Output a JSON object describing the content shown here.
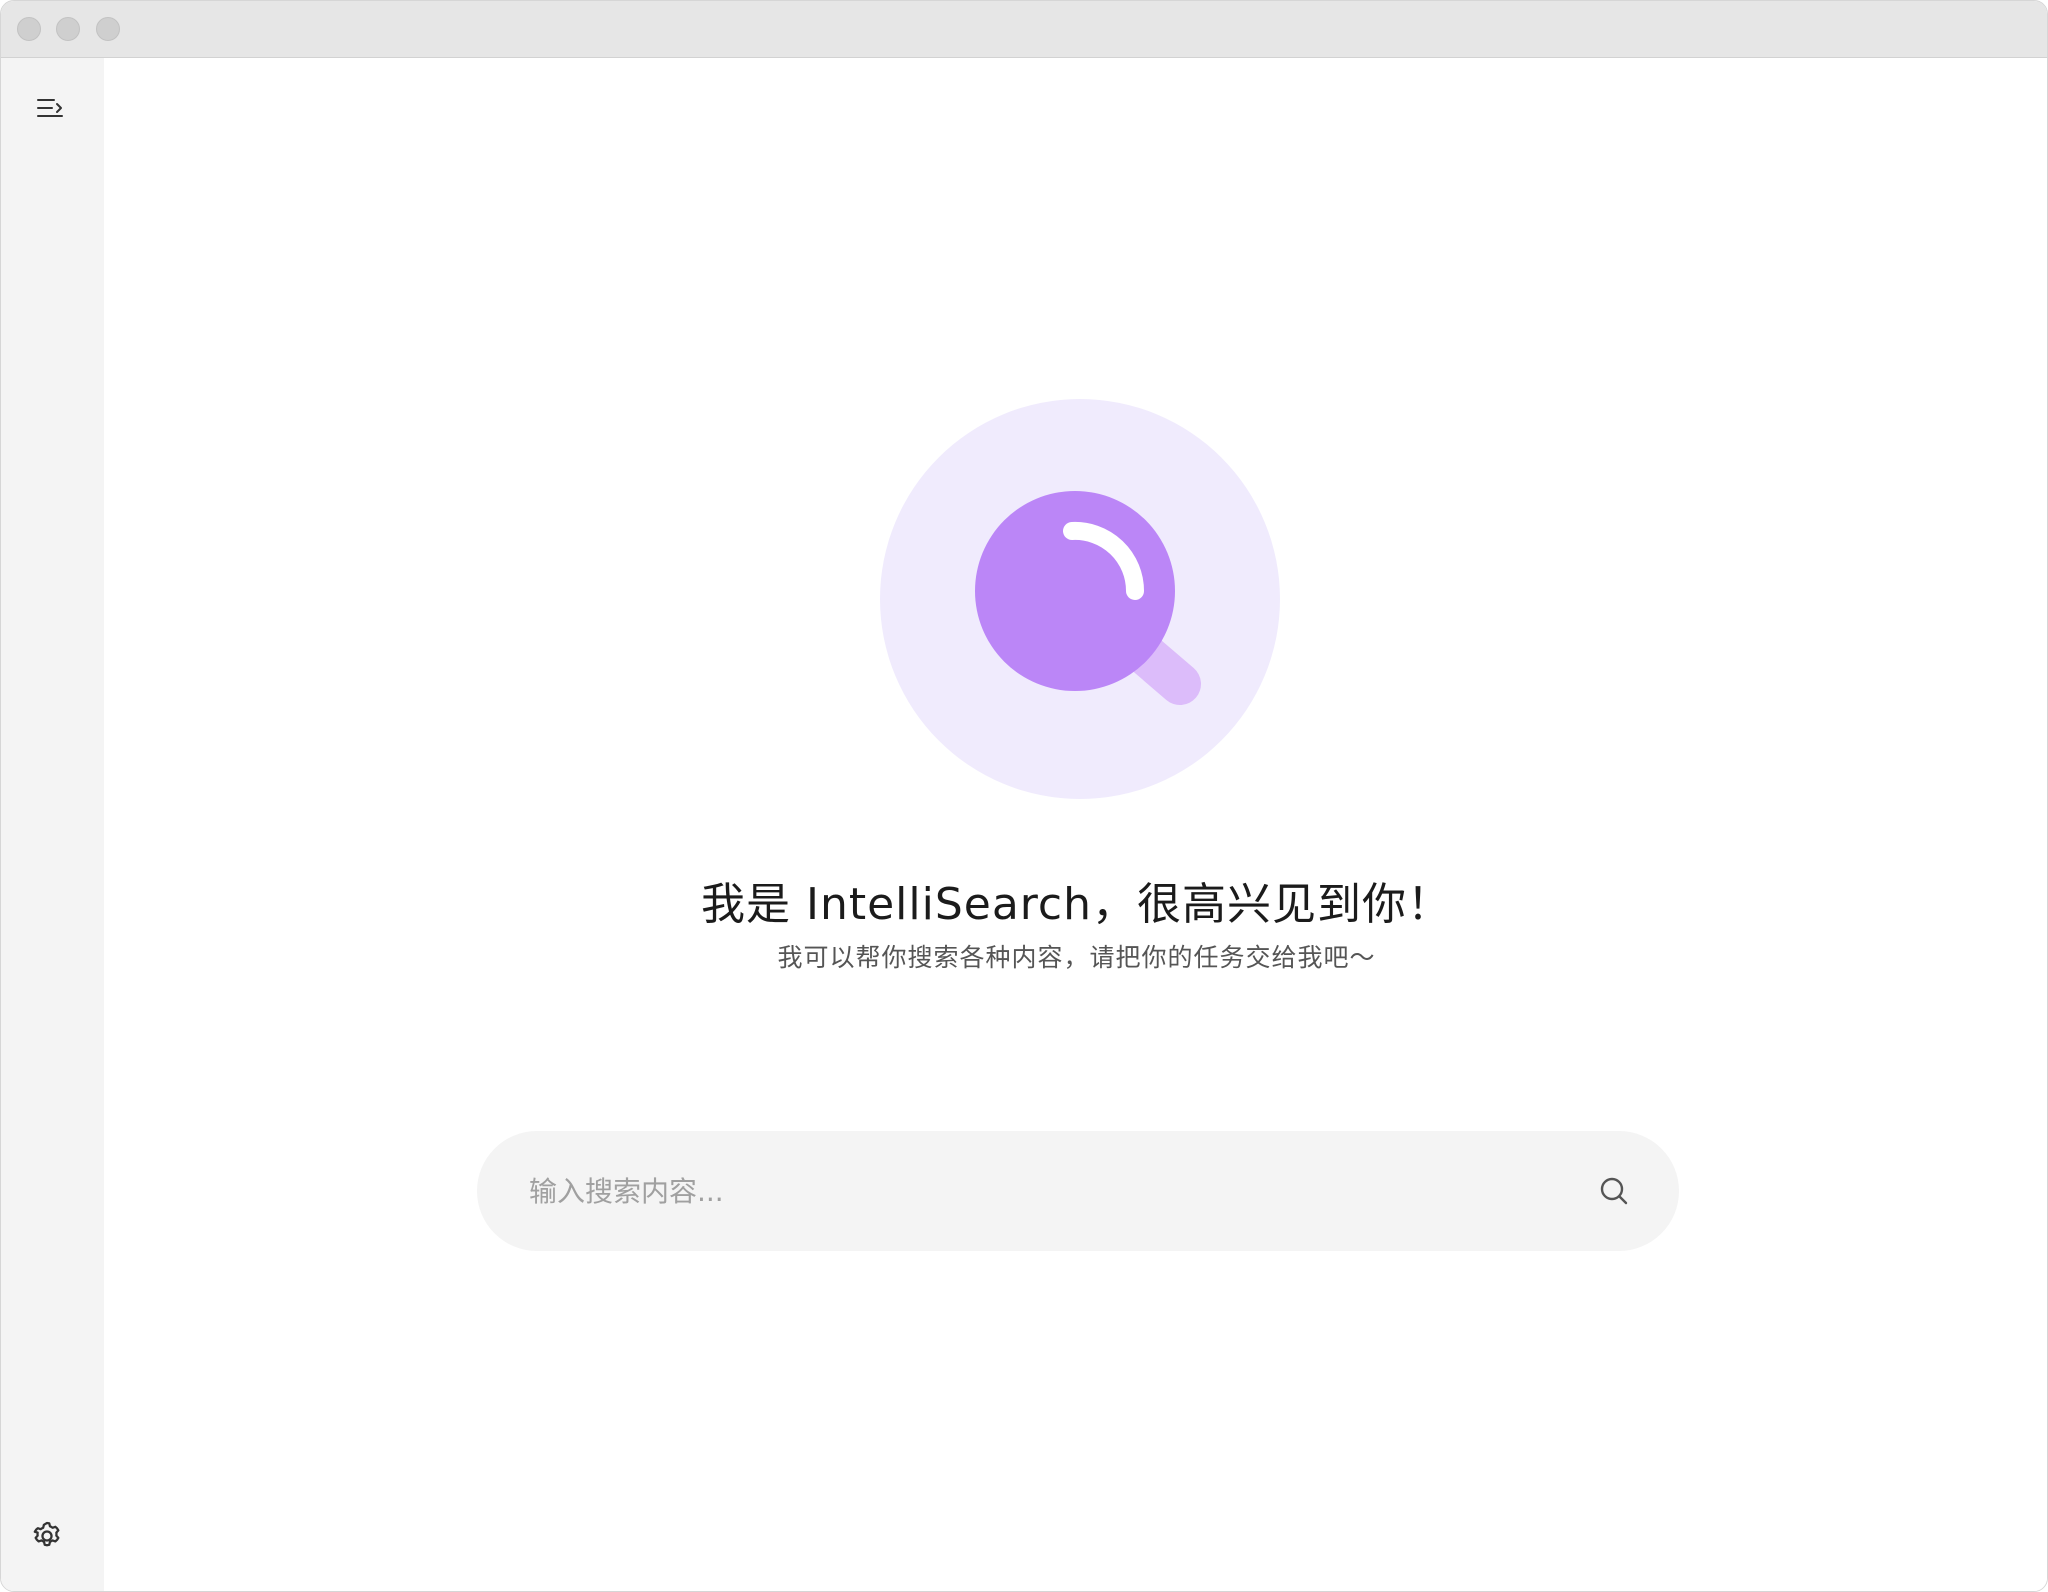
{
  "window": {
    "controls": [
      "close",
      "minimize",
      "maximize"
    ]
  },
  "sidebar": {
    "toggle_icon": "sidebar-toggle-icon",
    "settings_icon": "gear-icon"
  },
  "main": {
    "hero_icon": "magnifier-icon",
    "title": "我是 IntelliSearch，很高兴见到你！",
    "subtitle": "我可以帮你搜索各种内容，请把你的任务交给我吧～"
  },
  "search": {
    "placeholder": "输入搜索内容...",
    "value": "",
    "icon": "search-icon"
  },
  "colors": {
    "accent": "#bb86f7",
    "accent_light": "#f0ebfd",
    "handle": "#dcbcfa",
    "sidebar_bg": "#f4f4f4",
    "search_bg": "#f4f4f4"
  }
}
